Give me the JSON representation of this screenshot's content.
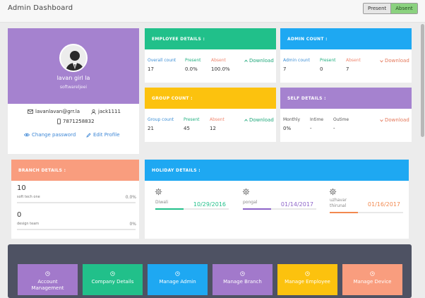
{
  "header": {
    "title": "Admin Dashboard",
    "toggle": {
      "present": "Present",
      "absent": "Absent",
      "selected": "Absent"
    }
  },
  "profile": {
    "name": "lavan girl la",
    "role": "softwareljeei",
    "email": "lavanlavan@grr.la",
    "username": "jack1111",
    "phone": "7871258832",
    "change_password": "Change password",
    "edit_profile": "Edit Profile",
    "colors": {
      "accent": "#a582cf"
    }
  },
  "employee": {
    "title": "EMPLOYEE DETAILS :",
    "color": "#21c08a",
    "labels": [
      "Overall count",
      "Present",
      "Absent"
    ],
    "values": [
      "17",
      "0.0%",
      "100.0%"
    ],
    "download": "Download"
  },
  "admin": {
    "title": "ADMIN COUNT :",
    "color": "#1ea8f2",
    "labels": [
      "Admin count",
      "Present",
      "Absent"
    ],
    "values": [
      "7",
      "0",
      "7"
    ],
    "download": "Download"
  },
  "group": {
    "title": "GROUP COUNT :",
    "color": "#fcc20e",
    "labels": [
      "Group count",
      "Present",
      "Absent"
    ],
    "values": [
      "21",
      "45",
      "12"
    ],
    "download": "Download"
  },
  "self": {
    "title": "SELF DETAILS :",
    "color": "#a582cf",
    "labels": [
      "Monthly",
      "Intime",
      "Outime"
    ],
    "values": [
      "0%",
      "-",
      "-"
    ],
    "download": "Download"
  },
  "branch": {
    "title": "BRANCH DETAILS :",
    "items": [
      {
        "count": "10",
        "name": "soft tech one",
        "percent": "0.0%"
      },
      {
        "count": "0",
        "name": "design team",
        "percent": "0%"
      }
    ]
  },
  "holiday": {
    "title": "HOLIDAY DETAILS :",
    "items": [
      {
        "name": "Diwali",
        "date": "10/29/2016",
        "color": "#21c08a",
        "progress": 0.38
      },
      {
        "name": "pongal",
        "date": "01/14/2017",
        "color": "#8c63c8",
        "progress": 0.38
      },
      {
        "name": "uzhavar\nthirunal",
        "date": "01/16/2017",
        "color": "#f2894f",
        "progress": 0.38
      }
    ]
  },
  "tiles": [
    {
      "label": "Account\nManagement",
      "color": "#a279cb",
      "icon": "clock-icon"
    },
    {
      "label": "Company Details",
      "color": "#21c08a",
      "icon": "clock-icon"
    },
    {
      "label": "Manage Admin",
      "color": "#1ea8f2",
      "icon": "clock-icon"
    },
    {
      "label": "Manage Branch",
      "color": "#a279cb",
      "icon": "clock-icon"
    },
    {
      "label": "Manage Employee",
      "color": "#fcc20e",
      "icon": "clock-icon"
    },
    {
      "label": "Manage Device",
      "color": "#f99d7e",
      "icon": "clock-icon"
    }
  ]
}
